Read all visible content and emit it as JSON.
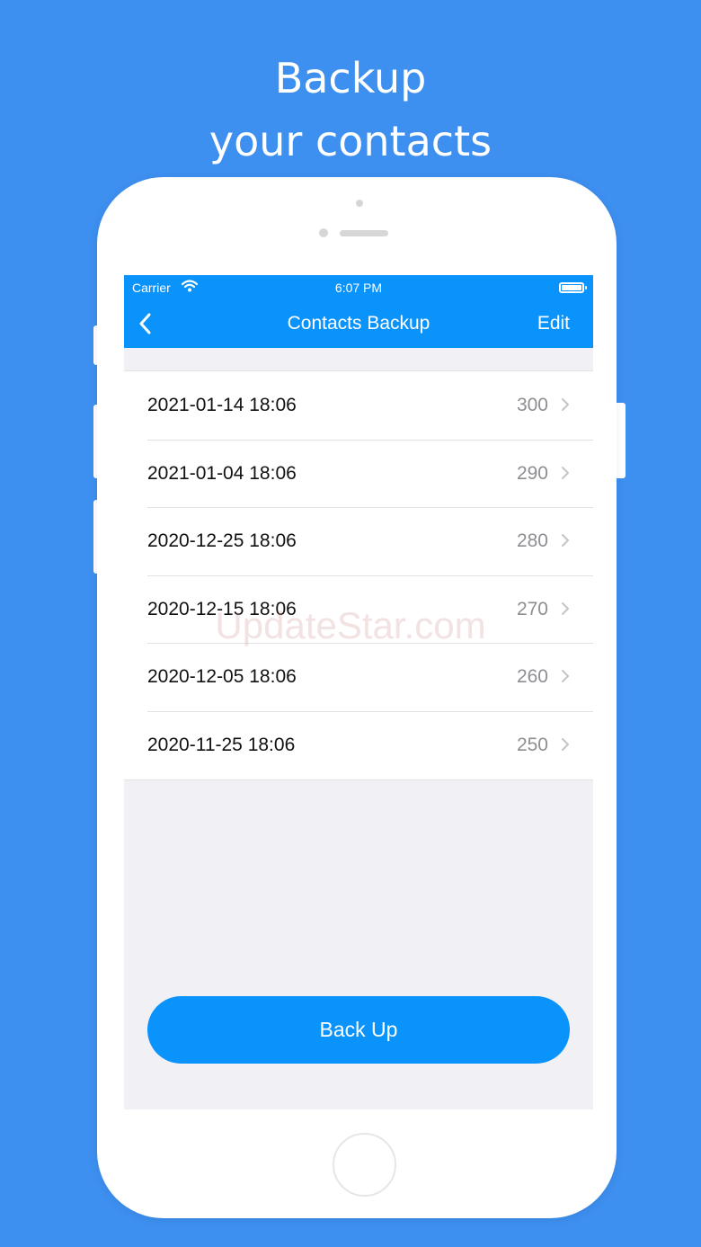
{
  "headline": {
    "line1": "Backup",
    "line2": "your contacts"
  },
  "status_bar": {
    "carrier": "Carrier",
    "time": "6:07 PM",
    "icons": [
      "wifi-icon",
      "battery-icon"
    ]
  },
  "nav_bar": {
    "back_icon": "chevron-left-icon",
    "title": "Contacts Backup",
    "edit_label": "Edit"
  },
  "backups": [
    {
      "date": "2021-01-14 18:06",
      "count": "300"
    },
    {
      "date": "2021-01-04 18:06",
      "count": "290"
    },
    {
      "date": "2020-12-25 18:06",
      "count": "280"
    },
    {
      "date": "2020-12-15 18:06",
      "count": "270"
    },
    {
      "date": "2020-12-05 18:06",
      "count": "260"
    },
    {
      "date": "2020-11-25 18:06",
      "count": "250"
    }
  ],
  "backup_button_label": "Back Up",
  "watermark": "UpdateStar.com",
  "colors": {
    "background": "#3d8ff0",
    "accent": "#0a93fb",
    "screen_bg": "#f0f0f5",
    "secondary_text": "#8e8e93"
  }
}
